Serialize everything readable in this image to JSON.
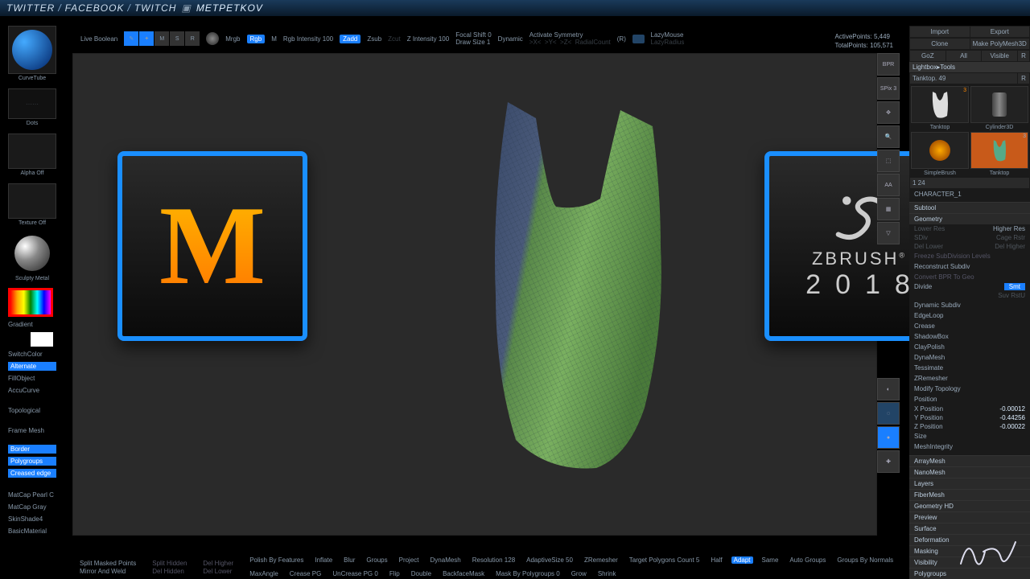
{
  "banner": {
    "t1": "TWITTER",
    "t2": "FACEBOOK",
    "t3": "TWITCH",
    "handle": "METPETKOV"
  },
  "topbar": {
    "liveBoolean": "Live Boolean",
    "gizmos": [
      "Edit",
      "Draw",
      "Move",
      "Scale",
      "Rotate"
    ],
    "mrgb": "Mrgb",
    "rgb": "Rgb",
    "m": "M",
    "rgbIntensity": "Rgb Intensity 100",
    "zadd": "Zadd",
    "zsub": "Zsub",
    "zcut": "Zcut",
    "zIntensity": "Z Intensity 100",
    "focal": "Focal Shift 0",
    "drawSize": "Draw Size 1",
    "dynamic": "Dynamic",
    "activateSym": "Activate Symmetry",
    "sym": "(R)",
    "lazy": "LazyMouse",
    "lazyR": "LazyRadius"
  },
  "stats": {
    "active": "ActivePoints: 5,449",
    "total": "TotalPoints: 105,571"
  },
  "left": {
    "brush": "CurveTube",
    "dots": "Dots",
    "alpha": "Alpha Off",
    "texture": "Texture Off",
    "material": "Sculpty Metal",
    "gradient": "Gradient",
    "switch": "SwitchColor",
    "alternate": "Alternate",
    "fill": "FillObject",
    "accu": "AccuCurve",
    "topo": "Topological",
    "frame": "Frame Mesh",
    "opts": [
      "Border",
      "Polygroups",
      "Creased edge"
    ],
    "matcaps": [
      "MatCap Pearl C",
      "MatCap Gray",
      "SkinShade4",
      "BasicMaterial"
    ]
  },
  "sideIcons": [
    "BPR",
    "SPix 3",
    "Scroll",
    "Zoom",
    "Actual",
    "AAHalf",
    "Persp",
    "Floor"
  ],
  "sideIcons2": [
    "Transp",
    "Ghost",
    "Solo",
    "Xpose"
  ],
  "rpanel": {
    "topBtns": [
      [
        "Import",
        "Export"
      ],
      [
        "Clone",
        "Make PolyMesh3D"
      ],
      [
        "GoZ",
        "All",
        "Visible",
        "R"
      ]
    ],
    "lightbox": "Lightbox▸Tools",
    "tool": "Tanktop. 49",
    "thumbs": [
      {
        "name": "Tanktop",
        "badge": "3"
      },
      {
        "name": "Cylinder3D",
        "badge": ""
      },
      {
        "name": "SimpleBrush",
        "badge": ""
      },
      {
        "name": "Tanktop",
        "badge": "3",
        "sel": true
      }
    ],
    "listHdr": "1   24",
    "listItem": "CHARACTER_1",
    "sections": [
      "Subtool",
      "Geometry"
    ],
    "geomRows": [
      {
        "l": "Lower Res",
        "r": "Higher Res",
        "rdim": false,
        "ldim": true
      },
      {
        "l": "SDiv",
        "r": "Cage   Rstr",
        "ldim": true,
        "rdim": true
      },
      {
        "l": "Del Lower",
        "r": "Del Higher",
        "ldim": true,
        "rdim": true
      },
      {
        "l": "Freeze SubDivision Levels",
        "r": "",
        "full": true,
        "dim": true
      },
      {
        "l": "Reconstruct Subdiv",
        "r": "",
        "full": true
      },
      {
        "l": "Convert BPR To Geo",
        "r": "",
        "full": true,
        "dim": true
      },
      {
        "l": "Divide",
        "r": "Smt",
        "hl": true
      },
      {
        "l": "",
        "r": "Suv   RstU",
        "rdim": true
      }
    ],
    "geoItems": [
      "Dynamic Subdiv",
      "EdgeLoop",
      "Crease",
      "ShadowBox",
      "ClayPolish",
      "DynaMesh",
      "Tessimate",
      "ZRemesher",
      "Modify Topology",
      "Position"
    ],
    "pos": [
      {
        "k": "X Position",
        "v": "-0.00012"
      },
      {
        "k": "Y Position",
        "v": "-0.44256"
      },
      {
        "k": "Z Position",
        "v": "-0.00022"
      }
    ],
    "afterPos": [
      "Size",
      "MeshIntegrity"
    ],
    "tail": [
      "ArrayMesh",
      "NanoMesh",
      "Layers",
      "FiberMesh",
      "Geometry HD",
      "Preview",
      "Surface",
      "Deformation",
      "Masking",
      "Visibility",
      "Polygroups"
    ]
  },
  "bottom": {
    "l1": [
      "Split Masked Points",
      "Split Hidden",
      "Del Higher"
    ],
    "l2": [
      "Mirror And Weld",
      "Del Hidden",
      "Del Lower"
    ],
    "mid": [
      "Polish By Features",
      "Inflate",
      "Blur",
      "Groups",
      "Project",
      "DynaMesh",
      "Resolution 128",
      "AdaptiveSize 50",
      "ZRemesher",
      "Target Polygons Count 5",
      "Half",
      "Adapt",
      "Same",
      "Auto Groups",
      "Groups By Normals",
      "MaxAngle",
      "Crease PG",
      "UnCrease PG 0",
      "Flip",
      "Double",
      "BackfaceMask",
      "Mask By Polygroups 0",
      "Grow",
      "Shrink"
    ]
  },
  "cards": {
    "m": "M",
    "zbrand": "ZBRUSH",
    "zyear": "2018"
  }
}
